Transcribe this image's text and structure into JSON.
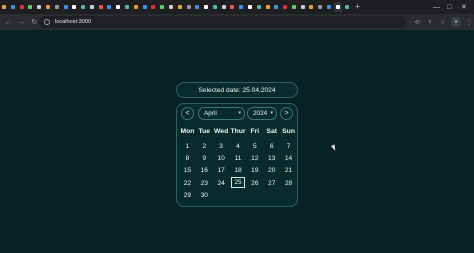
{
  "browser": {
    "tabs_count": 40,
    "active_tab_index": 38,
    "new_tab_label": "+",
    "window_controls": [
      "—",
      "□",
      "✕"
    ],
    "url": "localhost:3000",
    "nav": {
      "back": "←",
      "forward": "→",
      "reload": "↻"
    }
  },
  "app": {
    "selected_date_text": "Selected date: 25.04.2024",
    "month_select": "April",
    "year_select": "2024",
    "prev_button": "<",
    "next_button": ">",
    "weekdays": [
      "Mon",
      "Tue",
      "Wed",
      "Thur",
      "Fri",
      "Sat",
      "Sun"
    ],
    "days": [
      "1",
      "2",
      "3",
      "4",
      "5",
      "6",
      "7",
      "8",
      "9",
      "10",
      "11",
      "12",
      "13",
      "14",
      "15",
      "16",
      "17",
      "18",
      "19",
      "20",
      "21",
      "22",
      "23",
      "24",
      "25",
      "26",
      "27",
      "28",
      "29",
      "30"
    ],
    "selected_day": "25"
  },
  "colors": {
    "page_bg": "#062225",
    "card_border": "#2f6163",
    "text": "#e9f5f4"
  },
  "icons": {
    "cursor": "mouse-pointer-icon"
  }
}
